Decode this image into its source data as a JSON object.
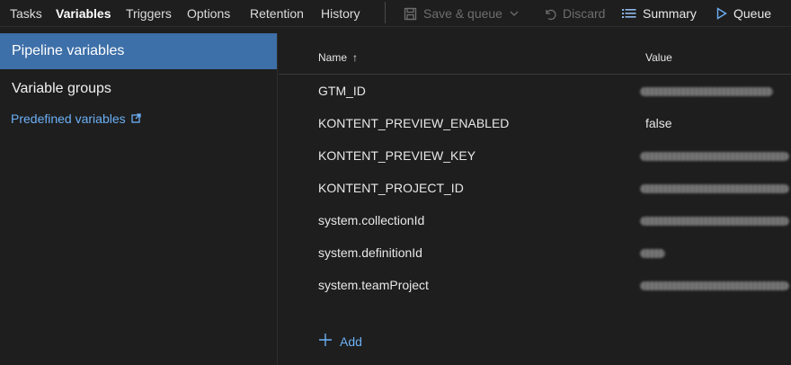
{
  "tabs": [
    {
      "label": "Tasks",
      "active": false
    },
    {
      "label": "Variables",
      "active": true
    },
    {
      "label": "Triggers",
      "active": false
    },
    {
      "label": "Options",
      "active": false
    },
    {
      "label": "Retention",
      "active": false
    },
    {
      "label": "History",
      "active": false
    }
  ],
  "toolbar": {
    "save_queue_label": "Save & queue",
    "discard_label": "Discard",
    "summary_label": "Summary",
    "queue_label": "Queue"
  },
  "sidebar": {
    "items": [
      {
        "label": "Pipeline variables",
        "selected": true
      },
      {
        "label": "Variable groups",
        "selected": false
      }
    ],
    "link_label": "Predefined variables"
  },
  "table": {
    "columns": {
      "name": "Name",
      "name_sort": "↑",
      "value": "Value"
    },
    "rows": [
      {
        "name": "GTM_ID",
        "value": "",
        "secret": true
      },
      {
        "name": "KONTENT_PREVIEW_ENABLED",
        "value": "false",
        "secret": false
      },
      {
        "name": "KONTENT_PREVIEW_KEY",
        "value": "",
        "secret": true
      },
      {
        "name": "KONTENT_PROJECT_ID",
        "value": "",
        "secret": true
      },
      {
        "name": "system.collectionId",
        "value": "",
        "secret": true
      },
      {
        "name": "system.definitionId",
        "value": "",
        "secret": true
      },
      {
        "name": "system.teamProject",
        "value": "",
        "secret": true
      }
    ]
  },
  "add_label": "Add",
  "colors": {
    "background": "#1e1e1e",
    "selected": "#3d6fa8",
    "link": "#6cb0f5",
    "disabled": "#6e6e6e"
  }
}
